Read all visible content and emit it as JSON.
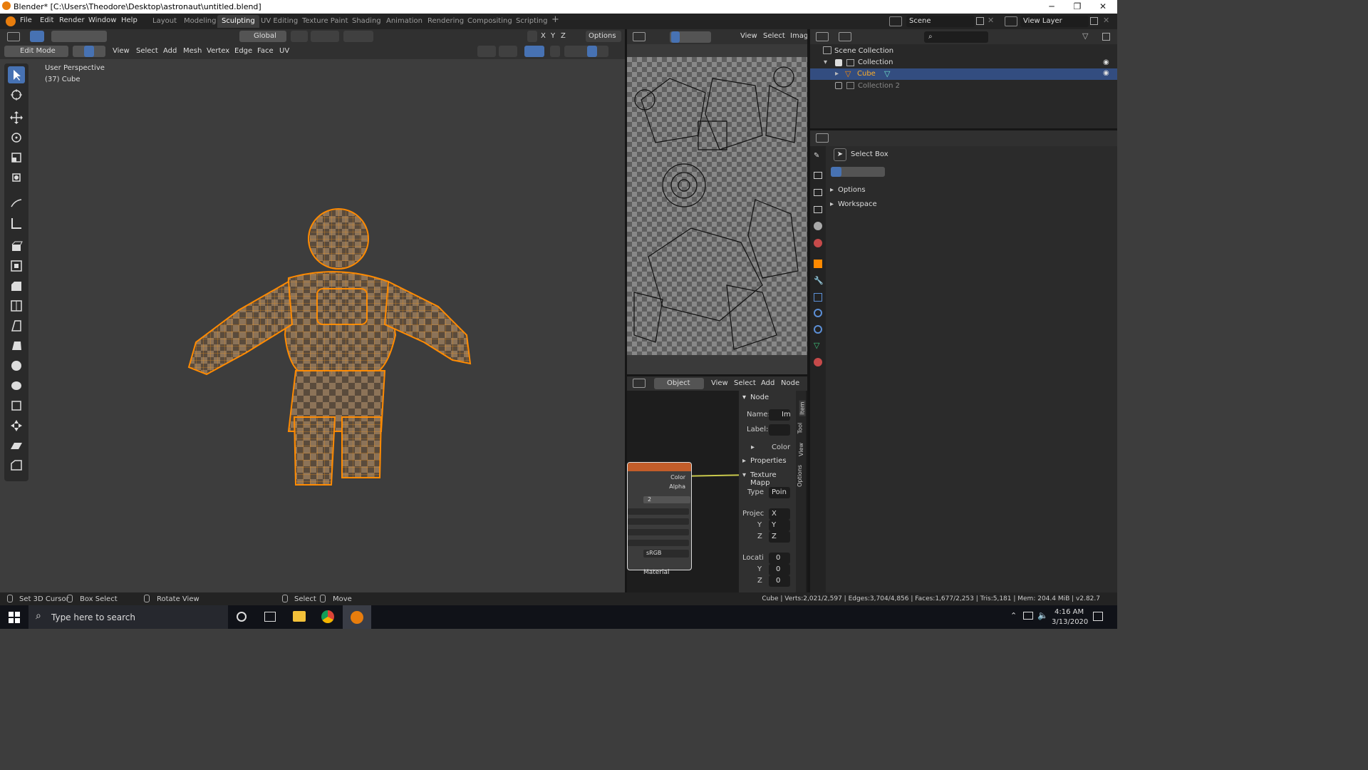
{
  "titlebar": {
    "title": "Blender* [C:\\Users\\Theodore\\Desktop\\astronaut\\untitled.blend]",
    "min_glyph": "─",
    "max_glyph": "❐",
    "close_glyph": "✕"
  },
  "menubar": {
    "items": [
      "File",
      "Edit",
      "Render",
      "Window",
      "Help"
    ]
  },
  "workspaces": {
    "tabs": [
      "Layout",
      "Modeling",
      "Sculpting",
      "UV Editing",
      "Texture Paint",
      "Shading",
      "Animation",
      "Rendering",
      "Compositing",
      "Scripting"
    ],
    "active": "Sculpting",
    "add_glyph": "+"
  },
  "scene": {
    "name": "Scene"
  },
  "view_layer": {
    "name": "View Layer"
  },
  "viewport": {
    "transform_orientation": "Global",
    "axes": [
      "X",
      "Y",
      "Z"
    ],
    "options_label": "Options",
    "mode": "Edit Mode",
    "menus": [
      "View",
      "Select",
      "Add",
      "Mesh",
      "Vertex",
      "Edge",
      "Face",
      "UV"
    ],
    "perspective_label": "User Perspective",
    "object_label": "(37) Cube"
  },
  "uv_editor": {
    "menus": [
      "View",
      "Select",
      "Image"
    ]
  },
  "node_editor": {
    "object_type": "Object",
    "menus": [
      "View",
      "Select",
      "Add",
      "Node"
    ],
    "node_socket_color": "Color",
    "node_socket_alpha": "Alpha",
    "node_users": "2",
    "colorspace": "sRGB",
    "material_label": "Material",
    "sidebar": {
      "section_node": "Node",
      "name_label": "Name:",
      "name_value": "Im",
      "label_label": "Label:",
      "color_label": "Color",
      "properties_label": "Properties",
      "texture_mapping_label": "Texture Mapp",
      "type_label": "Type",
      "type_value": "Poin",
      "projection_label": "Projec",
      "proj_x": "X",
      "proj_y_label": "Y",
      "proj_y": "Y",
      "proj_z_label": "Z",
      "proj_z": "Z",
      "location_label": "Locati",
      "loc_x": "0",
      "loc_y_label": "Y",
      "loc_y": "0",
      "loc_z_label": "Z",
      "loc_z": "0"
    },
    "tabs": [
      "Item",
      "Tool",
      "View",
      "Options"
    ]
  },
  "outliner": {
    "root": "Scene Collection",
    "items": [
      {
        "label": "Collection"
      },
      {
        "label": "Cube"
      },
      {
        "label": "Collection 2"
      }
    ]
  },
  "properties": {
    "tool_name": "Select Box",
    "panels": [
      "Options",
      "Workspace"
    ]
  },
  "statusbar": {
    "hints": [
      "Set 3D Cursor",
      "Box Select",
      "Rotate View",
      "Select",
      "Move"
    ],
    "stats": "Cube | Verts:2,021/2,597 | Edges:3,704/4,856 | Faces:1,677/2,253 | Tris:5,181 | Mem: 204.4 MiB | v2.82.7"
  },
  "taskbar": {
    "search_placeholder": "Type here to search",
    "time": "4:16 AM",
    "date": "3/13/2020"
  },
  "colors": {
    "accent": "#4772b3",
    "selection_orange": "#ff8a00",
    "header": "#303030"
  }
}
